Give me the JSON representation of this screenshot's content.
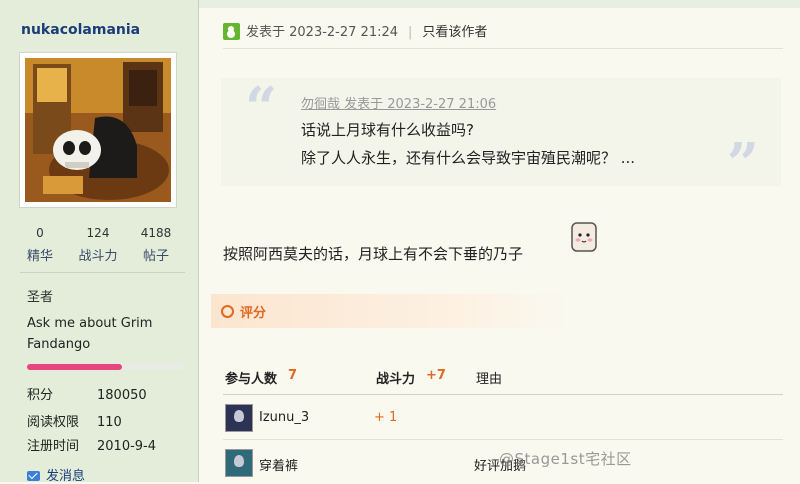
{
  "author": {
    "username": "nukacolamania",
    "stats": [
      {
        "value": "0",
        "label": "精华"
      },
      {
        "value": "124",
        "label": "战斗力"
      },
      {
        "value": "4188",
        "label": "帖子"
      }
    ],
    "rank_title": "圣者",
    "signature": "Ask me about Grim Fandango",
    "progress_fraction": 0.6,
    "info": [
      {
        "key": "积分",
        "value": "180050"
      },
      {
        "key": "阅读权限",
        "value": "110"
      },
      {
        "key": "注册时间",
        "value": "2010-9-4"
      }
    ],
    "send_message_label": "发消息"
  },
  "post": {
    "posted_at_label": "发表于 2023-2-27 21:24",
    "separator": "|",
    "author_only_label": "只看该作者",
    "quote": {
      "header": "勿徊哉 发表于 2023-2-27 21:06",
      "line1": "话说上月球有什么收益吗?",
      "line2": "除了人人永生，还有什么会导致宇宙殖民潮呢？ ...",
      "open_mark": "“",
      "close_mark": "”"
    },
    "reply_text": "按照阿西莫夫的话，月球上有不会下垂的乃子"
  },
  "rating": {
    "section_label": "评分",
    "participants_label": "参与人数",
    "participants_count": "7",
    "score_label": "战斗力",
    "score_total": "+7",
    "reason_label": "理由",
    "raters": [
      {
        "name": "Izunu_3",
        "score": "+ 1",
        "reason": ""
      },
      {
        "name": "穿着裤",
        "score": "",
        "reason": "好评加鹅"
      }
    ]
  },
  "watermark": "@Stage1st宅社区",
  "colors": {
    "sidebar_bg": "#e4edda",
    "page_bg": "#f9f9ef",
    "link_blue": "#1a3d7a",
    "accent_orange": "#e2691f",
    "progress_pink": "#e8447f",
    "online_green": "#66b531"
  }
}
